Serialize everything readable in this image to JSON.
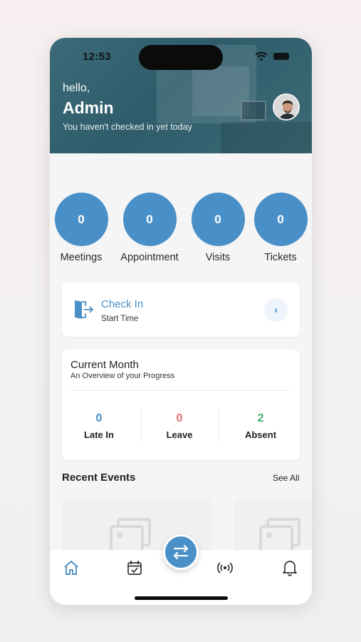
{
  "status_bar": {
    "time": "12:53"
  },
  "header": {
    "greeting": "hello,",
    "user_name": "Admin",
    "subtitle": "You haven't checked in yet today"
  },
  "stats": [
    {
      "label": "Meetings",
      "value": "0"
    },
    {
      "label": "Appointment",
      "value": "0"
    },
    {
      "label": "Visits",
      "value": "0"
    },
    {
      "label": "Tickets",
      "value": "0"
    }
  ],
  "check_in": {
    "title": "Check In",
    "subtitle": "Start Time",
    "icon": "door-enter-icon"
  },
  "current_month": {
    "title": "Current Month",
    "subtitle": "An Overview of your Progress",
    "items": [
      {
        "label": "Late In",
        "value": "0",
        "color": "#4a8fc5"
      },
      {
        "label": "Leave",
        "value": "0",
        "color": "#e06b6b"
      },
      {
        "label": "Absent",
        "value": "2",
        "color": "#3fae6a"
      }
    ]
  },
  "recent_events": {
    "title": "Recent Events",
    "see_all": "See All"
  },
  "tab_bar": {
    "items": [
      {
        "icon": "home-icon",
        "active": true
      },
      {
        "icon": "calendar-check-icon",
        "active": false
      },
      {
        "icon": "swap-icon",
        "active": false
      },
      {
        "icon": "broadcast-icon",
        "active": false
      },
      {
        "icon": "bell-icon",
        "active": false
      }
    ]
  },
  "colors": {
    "accent": "#4a90c8",
    "header": "#2f5c6b"
  }
}
